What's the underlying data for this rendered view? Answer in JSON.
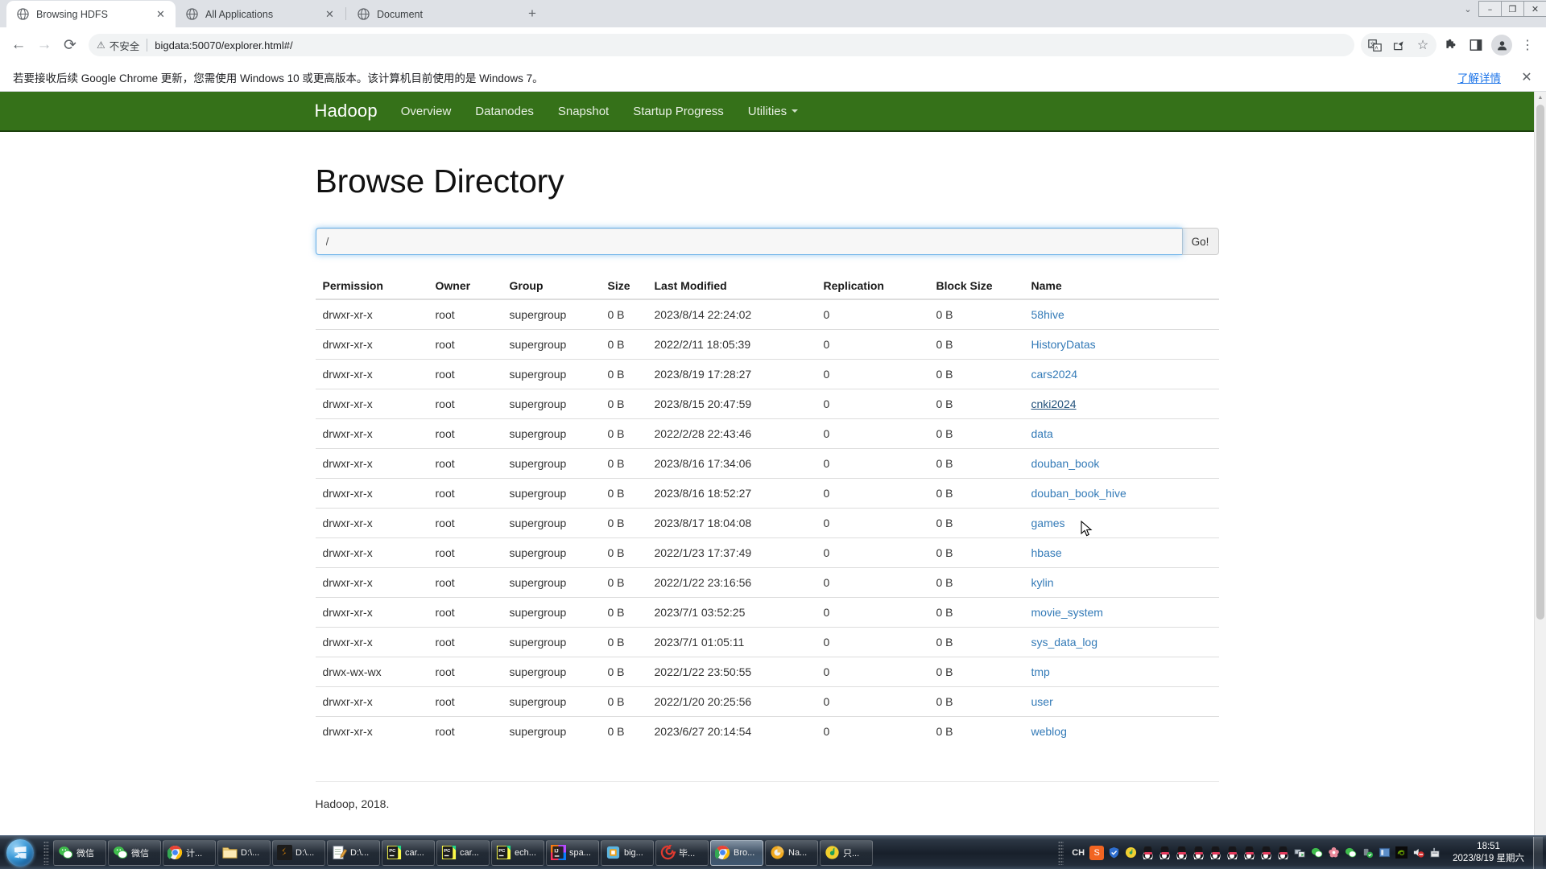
{
  "browser": {
    "tabs": [
      {
        "title": "Browsing HDFS",
        "favicon": "globe-icon",
        "active": true,
        "closable": true
      },
      {
        "title": "All Applications",
        "favicon": "globe-icon",
        "active": false,
        "closable": true
      },
      {
        "title": "Document",
        "favicon": "globe-icon",
        "active": false,
        "closable": false
      }
    ],
    "new_tab_label": "+",
    "window_controls": {
      "minimize": "–",
      "maximize": "❐",
      "close": "✕",
      "tab_search": "⌄"
    },
    "toolbar": {
      "back": "←",
      "forward": "→",
      "reload": "⟳",
      "security_warning": "不安全",
      "warning_icon": "⚠",
      "url": "bigdata:50070/explorer.html#/",
      "translate_icon": "translate-icon",
      "share_icon": "share-icon",
      "bookmark_icon": "☆",
      "extensions_icon": "puzzle-icon",
      "side_panel_icon": "panel-icon",
      "profile_icon": "●",
      "menu_icon": "⋮"
    },
    "infobar": {
      "message": "若要接收后续 Google Chrome 更新，您需使用 Windows 10 或更高版本。该计算机目前使用的是 Windows 7。",
      "link": "了解详情",
      "close": "✕"
    }
  },
  "hadoop": {
    "brand": "Hadoop",
    "nav": [
      {
        "label": "Overview",
        "dropdown": false
      },
      {
        "label": "Datanodes",
        "dropdown": false
      },
      {
        "label": "Snapshot",
        "dropdown": false
      },
      {
        "label": "Startup Progress",
        "dropdown": false
      },
      {
        "label": "Utilities",
        "dropdown": true
      }
    ],
    "page_title": "Browse Directory",
    "path_value": "/",
    "path_placeholder": "",
    "go_label": "Go!",
    "columns": [
      "Permission",
      "Owner",
      "Group",
      "Size",
      "Last Modified",
      "Replication",
      "Block Size",
      "Name"
    ],
    "rows": [
      {
        "permission": "drwxr-xr-x",
        "owner": "root",
        "group": "supergroup",
        "size": "0 B",
        "modified": "2023/8/14 22:24:02",
        "replication": "0",
        "block_size": "0 B",
        "name": "58hive",
        "hovered": false
      },
      {
        "permission": "drwxr-xr-x",
        "owner": "root",
        "group": "supergroup",
        "size": "0 B",
        "modified": "2022/2/11 18:05:39",
        "replication": "0",
        "block_size": "0 B",
        "name": "HistoryDatas",
        "hovered": false
      },
      {
        "permission": "drwxr-xr-x",
        "owner": "root",
        "group": "supergroup",
        "size": "0 B",
        "modified": "2023/8/19 17:28:27",
        "replication": "0",
        "block_size": "0 B",
        "name": "cars2024",
        "hovered": false
      },
      {
        "permission": "drwxr-xr-x",
        "owner": "root",
        "group": "supergroup",
        "size": "0 B",
        "modified": "2023/8/15 20:47:59",
        "replication": "0",
        "block_size": "0 B",
        "name": "cnki2024",
        "hovered": true
      },
      {
        "permission": "drwxr-xr-x",
        "owner": "root",
        "group": "supergroup",
        "size": "0 B",
        "modified": "2022/2/28 22:43:46",
        "replication": "0",
        "block_size": "0 B",
        "name": "data",
        "hovered": false
      },
      {
        "permission": "drwxr-xr-x",
        "owner": "root",
        "group": "supergroup",
        "size": "0 B",
        "modified": "2023/8/16 17:34:06",
        "replication": "0",
        "block_size": "0 B",
        "name": "douban_book",
        "hovered": false
      },
      {
        "permission": "drwxr-xr-x",
        "owner": "root",
        "group": "supergroup",
        "size": "0 B",
        "modified": "2023/8/16 18:52:27",
        "replication": "0",
        "block_size": "0 B",
        "name": "douban_book_hive",
        "hovered": false
      },
      {
        "permission": "drwxr-xr-x",
        "owner": "root",
        "group": "supergroup",
        "size": "0 B",
        "modified": "2023/8/17 18:04:08",
        "replication": "0",
        "block_size": "0 B",
        "name": "games",
        "hovered": false
      },
      {
        "permission": "drwxr-xr-x",
        "owner": "root",
        "group": "supergroup",
        "size": "0 B",
        "modified": "2022/1/23 17:37:49",
        "replication": "0",
        "block_size": "0 B",
        "name": "hbase",
        "hovered": false
      },
      {
        "permission": "drwxr-xr-x",
        "owner": "root",
        "group": "supergroup",
        "size": "0 B",
        "modified": "2022/1/22 23:16:56",
        "replication": "0",
        "block_size": "0 B",
        "name": "kylin",
        "hovered": false
      },
      {
        "permission": "drwxr-xr-x",
        "owner": "root",
        "group": "supergroup",
        "size": "0 B",
        "modified": "2023/7/1 03:52:25",
        "replication": "0",
        "block_size": "0 B",
        "name": "movie_system",
        "hovered": false
      },
      {
        "permission": "drwxr-xr-x",
        "owner": "root",
        "group": "supergroup",
        "size": "0 B",
        "modified": "2023/7/1 01:05:11",
        "replication": "0",
        "block_size": "0 B",
        "name": "sys_data_log",
        "hovered": false
      },
      {
        "permission": "drwx-wx-wx",
        "owner": "root",
        "group": "supergroup",
        "size": "0 B",
        "modified": "2022/1/22 23:50:55",
        "replication": "0",
        "block_size": "0 B",
        "name": "tmp",
        "hovered": false
      },
      {
        "permission": "drwxr-xr-x",
        "owner": "root",
        "group": "supergroup",
        "size": "0 B",
        "modified": "2022/1/20 20:25:56",
        "replication": "0",
        "block_size": "0 B",
        "name": "user",
        "hovered": false
      },
      {
        "permission": "drwxr-xr-x",
        "owner": "root",
        "group": "supergroup",
        "size": "0 B",
        "modified": "2023/6/27 20:14:54",
        "replication": "0",
        "block_size": "0 B",
        "name": "weblog",
        "hovered": false
      }
    ],
    "footer": "Hadoop, 2018."
  },
  "taskbar": {
    "start_label": "start-orb",
    "items": [
      {
        "label": "微信",
        "icon": "wechat-icon",
        "active": false
      },
      {
        "label": "微信",
        "icon": "wechat-icon",
        "active": false
      },
      {
        "label": "计...",
        "icon": "chrome-icon",
        "active": false
      },
      {
        "label": "D:\\...",
        "icon": "folder-icon",
        "active": false
      },
      {
        "label": "D:\\...",
        "icon": "sublime-icon",
        "active": false
      },
      {
        "label": "D:\\...",
        "icon": "notepad-icon",
        "active": false
      },
      {
        "label": "car...",
        "icon": "pycharm-icon",
        "active": false
      },
      {
        "label": "car...",
        "icon": "pycharm-icon",
        "active": false
      },
      {
        "label": "ech...",
        "icon": "pycharm-icon",
        "active": false
      },
      {
        "label": "spa...",
        "icon": "intellij-icon",
        "active": false
      },
      {
        "label": "big...",
        "icon": "vmware-icon",
        "active": false
      },
      {
        "label": "毕...",
        "icon": "spiral-icon",
        "active": false
      },
      {
        "label": "Bro...",
        "icon": "chrome-icon",
        "active": true
      },
      {
        "label": "Na...",
        "icon": "navicat-icon",
        "active": false
      },
      {
        "label": "只...",
        "icon": "qqmusic-icon",
        "active": false
      }
    ],
    "tray": {
      "ime": "CH",
      "icons": [
        "sogou-icon",
        "shield-icon",
        "qqmusic-icon",
        "qq-icon",
        "qq-icon",
        "qq-icon",
        "qq-icon",
        "qq-icon",
        "qq-icon",
        "qq-icon",
        "qq-icon",
        "qq-icon",
        "network-icon",
        "wechat-icon",
        "flower-icon",
        "wechat-icon",
        "usb-icon",
        "screen-icon",
        "nvidia-icon",
        "volume-muted-icon",
        "display-icon"
      ],
      "time": "18:51",
      "date": "2023/8/19 星期六"
    }
  },
  "colors": {
    "hadoop_green": "#357119",
    "link_blue": "#337ab7",
    "chrome_tabbar": "#dee1e6",
    "focus_blue": "#66afe9"
  }
}
